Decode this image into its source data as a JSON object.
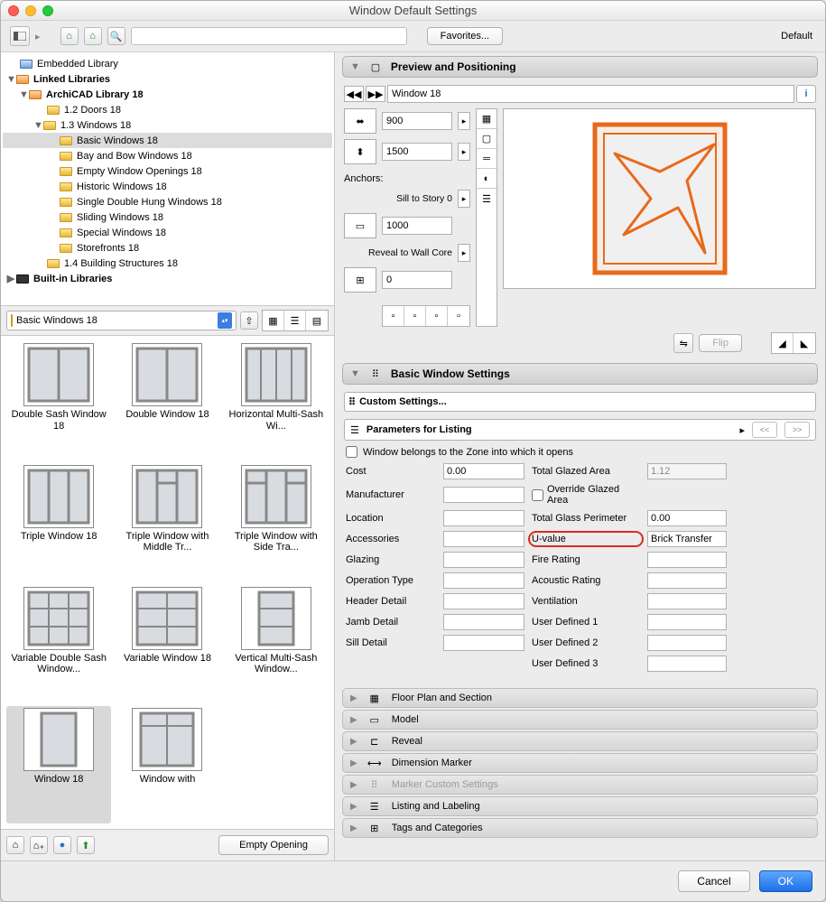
{
  "window": {
    "title": "Window Default Settings"
  },
  "toolbar": {
    "favorites": "Favorites...",
    "default_label": "Default"
  },
  "tree": {
    "embedded": "Embedded Library",
    "linked": "Linked Libraries",
    "archi": "ArchiCAD Library 18",
    "doors": "1.2 Doors 18",
    "windows": "1.3 Windows 18",
    "basic": "Basic Windows 18",
    "bay": "Bay and Bow Windows 18",
    "empty": "Empty Window Openings 18",
    "historic": "Historic Windows 18",
    "single": "Single Double Hung Windows 18",
    "sliding": "Sliding Windows 18",
    "special": "Special Windows 18",
    "store": "Storefronts 18",
    "bldg": "1.4 Building Structures 18",
    "builtin": "Built-in Libraries"
  },
  "gallery": {
    "header": "Basic Windows 18",
    "items": [
      "Double Sash Window 18",
      "Double Window 18",
      "Horizontal Multi-Sash Wi...",
      "Triple Window 18",
      "Triple Window with Middle Tr...",
      "Triple Window with Side Tra...",
      "Variable Double Sash Window...",
      "Variable Window 18",
      "Vertical Multi-Sash Window...",
      "Window 18",
      "Window with"
    ]
  },
  "left_footer": {
    "empty_opening": "Empty Opening"
  },
  "preview": {
    "section_title": "Preview and Positioning",
    "name": "Window 18",
    "width": "900",
    "height": "1500",
    "anchors_label": "Anchors:",
    "sill_label": "Sill to Story 0",
    "sill": "1000",
    "reveal_label": "Reveal to Wall Core",
    "reveal": "0",
    "flip": "Flip"
  },
  "basic": {
    "section_title": "Basic Window Settings",
    "custom": "Custom Settings...",
    "param_title": "Parameters for Listing",
    "nav_prev": "<<",
    "nav_next": ">>",
    "zone_check": "Window belongs to the Zone into which it opens"
  },
  "params": {
    "left": [
      {
        "label": "Cost",
        "value": "0.00"
      },
      {
        "label": "Manufacturer",
        "value": ""
      },
      {
        "label": "Location",
        "value": ""
      },
      {
        "label": "Accessories",
        "value": ""
      },
      {
        "label": "Glazing",
        "value": ""
      },
      {
        "label": "Operation Type",
        "value": ""
      },
      {
        "label": "Header Detail",
        "value": ""
      },
      {
        "label": "Jamb Detail",
        "value": ""
      },
      {
        "label": "Sill Detail",
        "value": ""
      }
    ],
    "right": [
      {
        "label": "Total Glazed Area",
        "value": "1.12",
        "ro": true
      },
      {
        "label": "Override Glazed Area",
        "value": "",
        "checkbox": true
      },
      {
        "label": "Total Glass Perimeter",
        "value": "0.00"
      },
      {
        "label": "U-value",
        "value": "Brick Transfer",
        "highlight": true
      },
      {
        "label": "Fire Rating",
        "value": ""
      },
      {
        "label": "Acoustic Rating",
        "value": ""
      },
      {
        "label": "Ventilation",
        "value": ""
      },
      {
        "label": "User Defined 1",
        "value": ""
      },
      {
        "label": "User Defined 2",
        "value": ""
      },
      {
        "label": "User Defined 3",
        "value": ""
      }
    ]
  },
  "collapsed": [
    "Floor Plan and Section",
    "Model",
    "Reveal",
    "Dimension Marker",
    "Marker Custom Settings",
    "Listing and Labeling",
    "Tags and Categories"
  ],
  "footer": {
    "cancel": "Cancel",
    "ok": "OK"
  }
}
